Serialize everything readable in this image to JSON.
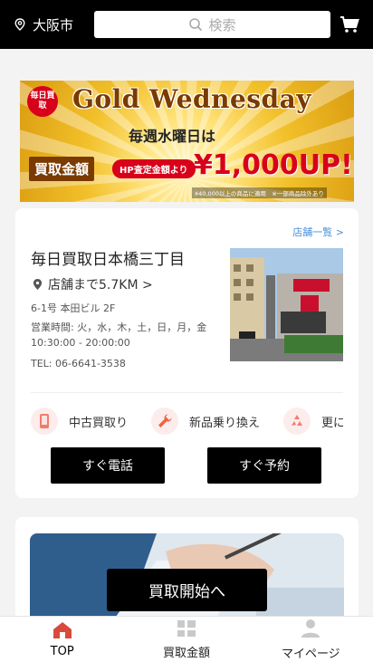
{
  "header": {
    "location": "大阪市",
    "search_placeholder": "検索"
  },
  "banner": {
    "badge": "毎日買取",
    "title": "Gold Wednesday",
    "subtitle": "毎週水曜日は",
    "left_label": "買取金額",
    "tag": "HP査定金額より",
    "price": "¥1,000UP!",
    "note": "¥40,000以上の商品に適用　※一部商品除外あり",
    "colors": {
      "brown": "#7a3a00",
      "red": "#d8001a",
      "gold": "#f2c02a"
    }
  },
  "store": {
    "list_link": "店舗一覧 >",
    "name": "毎日買取日本橋三丁目",
    "distance": "店舗まで5.7KM >",
    "address": "6-1号 本田ビル 2F",
    "hours_label": "営業時間: 火，水，木，土，日，月，金",
    "hours_time": "10:30:00 - 20:00:00",
    "tel": "TEL: 06-6641-3538",
    "services": [
      {
        "label": "中古買取り",
        "icon": "phone-icon"
      },
      {
        "label": "新品乗り換え",
        "icon": "wrench-icon"
      },
      {
        "label": "更に",
        "icon": "recycle-icon"
      }
    ],
    "call_button": "すぐ電話",
    "reserve_button": "すぐ予約"
  },
  "promo": {
    "button": "買取開始へ"
  },
  "tabbar": {
    "items": [
      {
        "label": "TOP",
        "icon": "home-icon",
        "active": true
      },
      {
        "label": "買取金額",
        "icon": "grid-icon",
        "active": false
      },
      {
        "label": "マイページ",
        "icon": "user-icon",
        "active": false
      }
    ]
  }
}
